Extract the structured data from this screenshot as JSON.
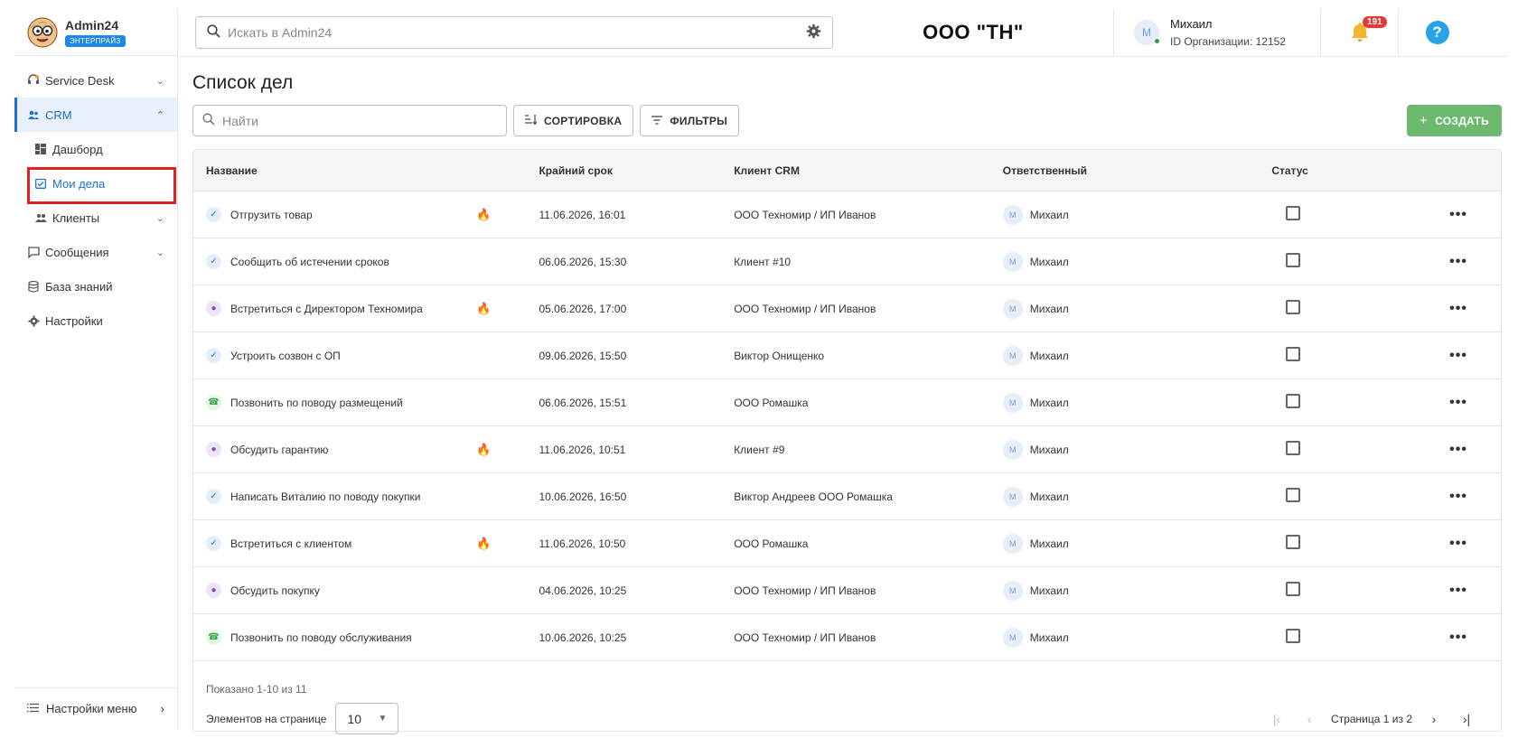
{
  "app": {
    "name": "Admin24",
    "edition_badge": "ЭНТЕРПРАЙЗ"
  },
  "sidebar": {
    "items": [
      {
        "label": "Service Desk",
        "icon": "headset-icon",
        "chevron": "⌄"
      },
      {
        "label": "CRM",
        "icon": "people-icon",
        "chevron": "⌃"
      },
      {
        "label": "Дашборд",
        "icon": "dashboard-icon"
      },
      {
        "label": "Мои дела",
        "icon": "calendar-check-icon"
      },
      {
        "label": "Клиенты",
        "icon": "clients-icon",
        "chevron": "⌄"
      },
      {
        "label": "Сообщения",
        "icon": "chat-icon",
        "chevron": "⌄"
      },
      {
        "label": "База знаний",
        "icon": "database-icon"
      },
      {
        "label": "Настройки",
        "icon": "gear-icon"
      }
    ],
    "bottom_label": "Настройки меню",
    "bottom_chevron": "›"
  },
  "header": {
    "search_placeholder": "Искать в Admin24",
    "org_title": "ООО \"ТН\"",
    "user_initial": "М",
    "user_name": "Михаил",
    "user_org": "ID Организации: 12152",
    "notifications_count": "191",
    "help_label": "?"
  },
  "main": {
    "title": "Список дел",
    "search_placeholder": "Найти",
    "sort_label": "СОРТИРОВКА",
    "filter_label": "ФИЛЬТРЫ",
    "create_label": "СОЗДАТЬ",
    "columns": [
      "Название",
      "Крайний срок",
      "Клиент CRM",
      "Ответственный",
      "Статус"
    ],
    "rows": [
      {
        "type": "task",
        "name": "Отгрузить товар",
        "priority": "medium",
        "deadline": "11.06.2026, 16:01",
        "client": "ООО Техномир / ИП Иванов",
        "responsible": "Михаил",
        "resp_initial": "М"
      },
      {
        "type": "task",
        "name": "Сообщить об истечении сроков",
        "priority": "",
        "deadline": "06.06.2026, 15:30",
        "client": "Клиент #10",
        "responsible": "Михаил",
        "resp_initial": "М"
      },
      {
        "type": "meeting",
        "name": "Встретиться с Директором Техномира",
        "priority": "medium",
        "deadline": "05.06.2026, 17:00",
        "client": "ООО Техномир / ИП Иванов",
        "responsible": "Михаил",
        "resp_initial": "М"
      },
      {
        "type": "task",
        "name": "Устроить созвон с ОП",
        "priority": "",
        "deadline": "09.06.2026, 15:50",
        "client": "Виктор Онищенко",
        "responsible": "Михаил",
        "resp_initial": "М"
      },
      {
        "type": "call",
        "name": "Позвонить по поводу размещений",
        "priority": "",
        "deadline": "06.06.2026, 15:51",
        "client": "ООО Ромашка",
        "responsible": "Михаил",
        "resp_initial": "М"
      },
      {
        "type": "meeting",
        "name": "Обсудить гарантию",
        "priority": "high",
        "deadline": "11.06.2026, 10:51",
        "client": "Клиент #9",
        "responsible": "Михаил",
        "resp_initial": "М"
      },
      {
        "type": "task",
        "name": "Написать Виталию по поводу покупки",
        "priority": "",
        "deadline": "10.06.2026, 16:50",
        "client": "Виктор Андреев ООО Ромашка",
        "responsible": "Михаил",
        "resp_initial": "М"
      },
      {
        "type": "task",
        "name": "Встретиться с клиентом",
        "priority": "high",
        "deadline": "11.06.2026, 10:50",
        "client": "ООО Ромашка",
        "responsible": "Михаил",
        "resp_initial": "М"
      },
      {
        "type": "meeting",
        "name": "Обсудить покупку",
        "priority": "",
        "deadline": "04.06.2026, 10:25",
        "client": "ООО Техномир / ИП Иванов",
        "responsible": "Михаил",
        "resp_initial": "М"
      },
      {
        "type": "call",
        "name": "Позвонить по поводу обслуживания",
        "priority": "",
        "deadline": "10.06.2026, 10:25",
        "client": "ООО Техномир / ИП Иванов",
        "responsible": "Михаил",
        "resp_initial": "М"
      }
    ],
    "footer": {
      "shown": "Показано 1-10 из 11",
      "per_page_label": "Элементов на странице",
      "per_page_value": "10",
      "page_text": "Страница 1 из 2"
    }
  },
  "colors": {
    "accent": "#1e6fd0",
    "create": "#6cb86c",
    "badge": "#e53935",
    "highlight": "#e02020"
  }
}
